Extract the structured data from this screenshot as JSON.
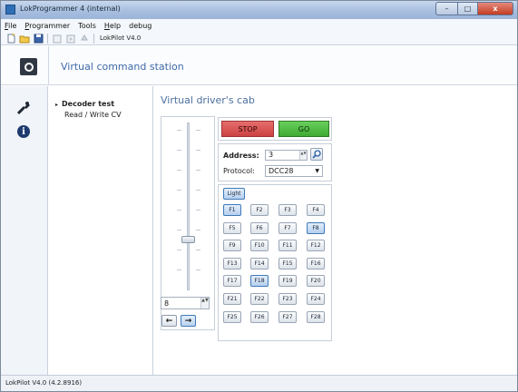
{
  "window": {
    "title": "LokProgrammer 4 (internal)",
    "controls": {
      "minimize": "–",
      "maximize": "□",
      "close": "x"
    }
  },
  "menu": [
    {
      "pre": "",
      "ul": "F",
      "post": "ile"
    },
    {
      "pre": "",
      "ul": "P",
      "post": "rogrammer"
    },
    {
      "pre": "Tools",
      "ul": "",
      "post": ""
    },
    {
      "pre": "",
      "ul": "H",
      "post": "elp"
    },
    {
      "pre": "debug",
      "ul": "",
      "post": ""
    }
  ],
  "toolbar": {
    "decoder_label": "LokPilot V4.0",
    "icons": [
      "new-icon",
      "open-icon",
      "save-icon",
      "read-icon",
      "write-icon",
      "reset-icon"
    ]
  },
  "header": {
    "title": "Virtual command station",
    "icon": "command-station-icon"
  },
  "leftstrip": {
    "icons": [
      "tools-icon",
      "info-icon"
    ],
    "info_glyph": "i"
  },
  "nav": {
    "bullet": "▸",
    "items": [
      {
        "label": "Decoder test",
        "selected": true
      },
      {
        "label": "Read / Write CV",
        "selected": false
      }
    ]
  },
  "cab": {
    "title": "Virtual driver's cab",
    "speed_value": "8",
    "spin_glyph": "▲▼",
    "dir_back": "←",
    "dir_fwd": "→",
    "active_direction": "forward",
    "stop_label": "STOP",
    "go_label": "GO",
    "stop_color": "#d64f4f",
    "go_color": "#4dbb40",
    "address_label": "Address:",
    "address_value": "3",
    "protocol_label": "Protocol:",
    "protocol_value": "DCC28",
    "light_label": "Light",
    "functions": [
      {
        "label": "F1",
        "active": true
      },
      {
        "label": "F2",
        "active": false
      },
      {
        "label": "F3",
        "active": false
      },
      {
        "label": "F4",
        "active": false
      },
      {
        "label": "F5",
        "active": false
      },
      {
        "label": "F6",
        "active": false
      },
      {
        "label": "F7",
        "active": false
      },
      {
        "label": "F8",
        "active": true
      },
      {
        "label": "F9",
        "active": false
      },
      {
        "label": "F10",
        "active": false
      },
      {
        "label": "F11",
        "active": false
      },
      {
        "label": "F12",
        "active": false
      },
      {
        "label": "F13",
        "active": false
      },
      {
        "label": "F14",
        "active": false
      },
      {
        "label": "F15",
        "active": false
      },
      {
        "label": "F16",
        "active": false
      },
      {
        "label": "F17",
        "active": false
      },
      {
        "label": "F18",
        "active": true
      },
      {
        "label": "F19",
        "active": false
      },
      {
        "label": "F20",
        "active": false
      },
      {
        "label": "F21",
        "active": false
      },
      {
        "label": "F22",
        "active": false
      },
      {
        "label": "F23",
        "active": false
      },
      {
        "label": "F24",
        "active": false
      },
      {
        "label": "F25",
        "active": false
      },
      {
        "label": "F26",
        "active": false
      },
      {
        "label": "F27",
        "active": false
      },
      {
        "label": "F28",
        "active": false
      }
    ]
  },
  "status": {
    "text": "LokPilot V4.0 (4.2.8916)"
  }
}
